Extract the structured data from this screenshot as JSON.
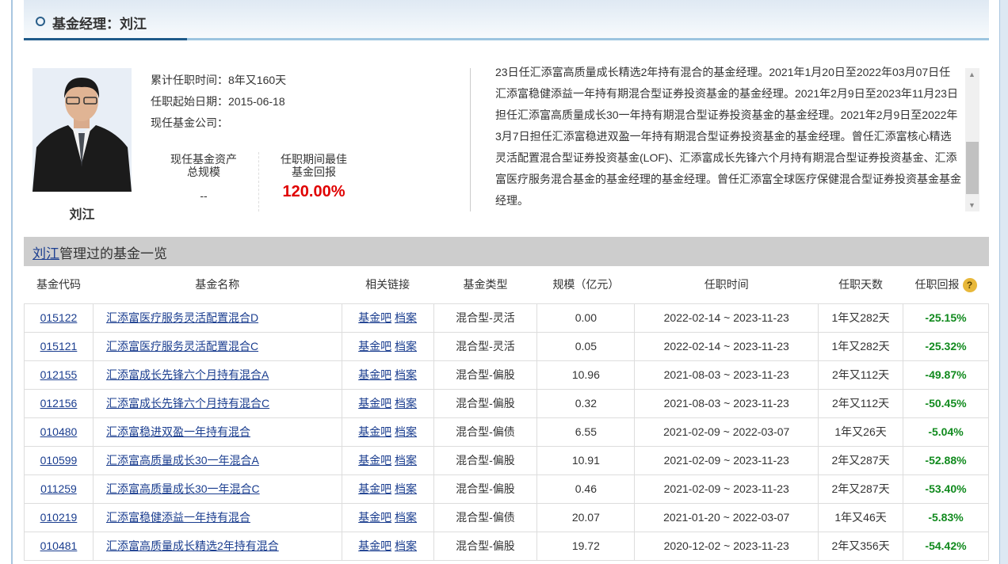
{
  "header": {
    "title": "基金经理：刘江"
  },
  "manager": {
    "name": "刘江",
    "tenure_label": "累计任职时间：",
    "tenure": "8年又160天",
    "start_label": "任职起始日期：",
    "start": "2015-06-18",
    "company_label": "现任基金公司：",
    "assets_label_1": "现任基金资产",
    "assets_label_2": "总规模",
    "assets_value": "--",
    "best_label_1": "任职期间最佳",
    "best_label_2": "基金回报",
    "best_value": "120.00%",
    "bio": "23日任汇添富高质量成长精选2年持有混合的基金经理。2021年1月20日至2022年03月07日任汇添富稳健添益一年持有期混合型证券投资基金的基金经理。2021年2月9日至2023年11月23日担任汇添富高质量成长30一年持有期混合型证券投资基金的基金经理。2021年2月9日至2022年3月7日担任汇添富稳进双盈一年持有期混合型证券投资基金的基金经理。曾任汇添富核心精选灵活配置混合型证券投资基金(LOF)、汇添富成长先锋六个月持有期混合型证券投资基金、汇添富医疗服务混合基金的基金经理的基金经理。曾任汇添富全球医疗保健混合型证券投资基金基金经理。"
  },
  "list": {
    "name_link": "刘江",
    "title_rest": "管理过的基金一览"
  },
  "table": {
    "headers": [
      "基金代码",
      "基金名称",
      "相关链接",
      "基金类型",
      "规模（亿元）",
      "任职时间",
      "任职天数",
      "任职回报"
    ],
    "help_icon": "question-icon",
    "link1": "基金吧",
    "link2": "档案",
    "rows": [
      [
        "015122",
        "汇添富医疗服务灵活配置混合D",
        "混合型-灵活",
        "0.00",
        "2022-02-14 ~ 2023-11-23",
        "1年又282天",
        "-25.15%"
      ],
      [
        "015121",
        "汇添富医疗服务灵活配置混合C",
        "混合型-灵活",
        "0.05",
        "2022-02-14 ~ 2023-11-23",
        "1年又282天",
        "-25.32%"
      ],
      [
        "012155",
        "汇添富成长先锋六个月持有混合A",
        "混合型-偏股",
        "10.96",
        "2021-08-03 ~ 2023-11-23",
        "2年又112天",
        "-49.87%"
      ],
      [
        "012156",
        "汇添富成长先锋六个月持有混合C",
        "混合型-偏股",
        "0.32",
        "2021-08-03 ~ 2023-11-23",
        "2年又112天",
        "-50.45%"
      ],
      [
        "010480",
        "汇添富稳进双盈一年持有混合",
        "混合型-偏债",
        "6.55",
        "2021-02-09 ~ 2022-03-07",
        "1年又26天",
        "-5.04%"
      ],
      [
        "010599",
        "汇添富高质量成长30一年混合A",
        "混合型-偏股",
        "10.91",
        "2021-02-09 ~ 2023-11-23",
        "2年又287天",
        "-52.88%"
      ],
      [
        "011259",
        "汇添富高质量成长30一年混合C",
        "混合型-偏股",
        "0.46",
        "2021-02-09 ~ 2023-11-23",
        "2年又287天",
        "-53.40%"
      ],
      [
        "010219",
        "汇添富稳健添益一年持有混合",
        "混合型-偏债",
        "20.07",
        "2021-01-20 ~ 2022-03-07",
        "1年又46天",
        "-5.83%"
      ],
      [
        "010481",
        "汇添富高质量成长精选2年持有混合",
        "混合型-偏股",
        "19.72",
        "2020-12-02 ~ 2023-11-23",
        "2年又356天",
        "-54.42%"
      ]
    ]
  },
  "colors": {
    "link": "#1a3d8f",
    "negative_return": "#118a1e",
    "best_return": "#e00000"
  }
}
